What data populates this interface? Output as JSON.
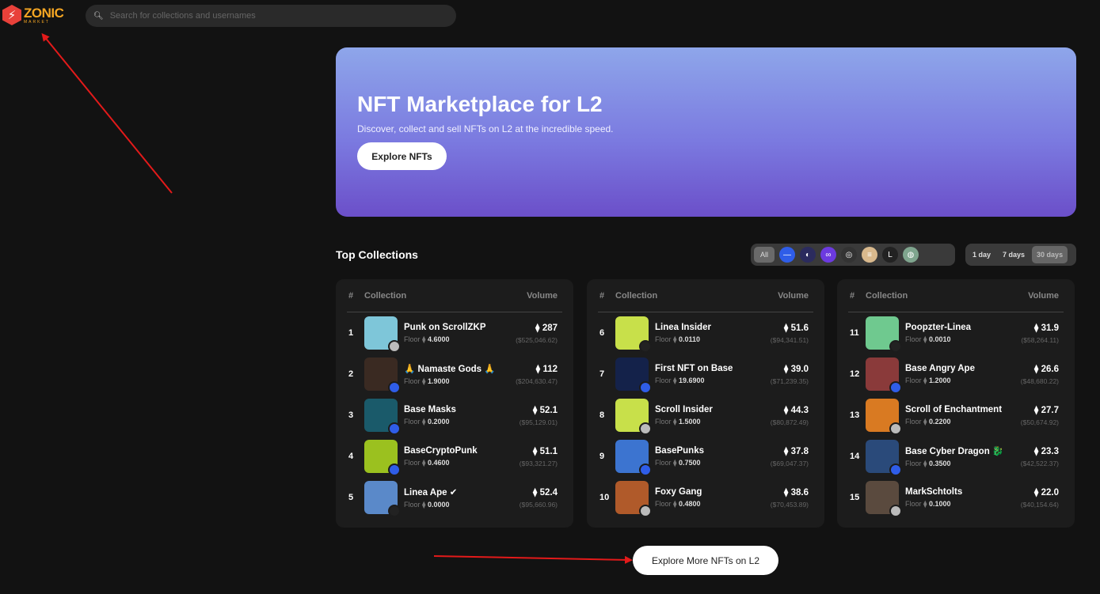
{
  "header": {
    "logo_text": "ZONIC",
    "logo_sub": "MARKET",
    "search_placeholder": "Search for collections and usernames"
  },
  "hero": {
    "title": "NFT Marketplace for L2",
    "subtitle": "Discover, collect and sell NFTs on L2 at the incredible speed.",
    "button": "Explore NFTs"
  },
  "top": {
    "title": "Top Collections",
    "chain_all": "All",
    "chains": [
      {
        "icon": "base-icon",
        "color": "#2f5de8",
        "glyph": "—"
      },
      {
        "icon": "arbitrum-nova-icon",
        "color": "#2b2b5e",
        "glyph": "◐"
      },
      {
        "icon": "polygon-zkevm-icon",
        "color": "#6c3ae0",
        "glyph": "∞"
      },
      {
        "icon": "zora-icon",
        "color": "#333",
        "glyph": "◎"
      },
      {
        "icon": "scroll-icon",
        "color": "#d9b98d",
        "glyph": "≡"
      },
      {
        "icon": "linea-icon",
        "color": "#222",
        "glyph": "L"
      },
      {
        "icon": "globe-icon",
        "color": "#7fa58e",
        "glyph": "◍"
      }
    ],
    "periods": [
      "1 day",
      "7 days",
      "30 days"
    ],
    "active_period": "30 days",
    "head": {
      "num": "#",
      "collection": "Collection",
      "volume": "Volume"
    },
    "floor_label": "Floor",
    "eth": "⧫"
  },
  "columns": [
    [
      {
        "rank": "1",
        "name": "Punk on ScrollZKP",
        "floor": "4.6000",
        "vol": "287",
        "usd": "($525,046.62)",
        "thumb": "#7ec6d9",
        "badge": "#bbb"
      },
      {
        "rank": "2",
        "name": "🙏 Namaste Gods 🙏",
        "floor": "1.9000",
        "vol": "112",
        "usd": "($204,630.47)",
        "thumb": "#3a2a22",
        "badge": "#2f5de8"
      },
      {
        "rank": "3",
        "name": "Base Masks",
        "floor": "0.2000",
        "vol": "52.1",
        "usd": "($95,129.01)",
        "thumb": "#1a5a6a",
        "badge": "#2f5de8"
      },
      {
        "rank": "4",
        "name": "BaseCryptoPunk",
        "floor": "0.4600",
        "vol": "51.1",
        "usd": "($93,321.27)",
        "thumb": "#9bc11f",
        "badge": "#2f5de8"
      },
      {
        "rank": "5",
        "name": "Linea Ape ✔",
        "floor": "0.0000",
        "vol": "52.4",
        "usd": "($95,660.96)",
        "thumb": "#5a89c9",
        "badge": "#222"
      }
    ],
    [
      {
        "rank": "6",
        "name": "Linea Insider",
        "floor": "0.0110",
        "vol": "51.6",
        "usd": "($94,341.51)",
        "thumb": "#c8e04a",
        "badge": "#222"
      },
      {
        "rank": "7",
        "name": "First NFT on Base",
        "floor": "19.6900",
        "vol": "39.0",
        "usd": "($71,239.35)",
        "thumb": "#14224a",
        "badge": "#2f5de8"
      },
      {
        "rank": "8",
        "name": "Scroll Insider",
        "floor": "1.5000",
        "vol": "44.3",
        "usd": "($80,872.49)",
        "thumb": "#c8e04a",
        "badge": "#bbb"
      },
      {
        "rank": "9",
        "name": "BasePunks",
        "floor": "0.7500",
        "vol": "37.8",
        "usd": "($69,047.37)",
        "thumb": "#3c74d0",
        "badge": "#2f5de8"
      },
      {
        "rank": "10",
        "name": "Foxy Gang",
        "floor": "0.4800",
        "vol": "38.6",
        "usd": "($70,453.89)",
        "thumb": "#b05a2a",
        "badge": "#bbb"
      }
    ],
    [
      {
        "rank": "11",
        "name": "Poopzter-Linea",
        "floor": "0.0010",
        "vol": "31.9",
        "usd": "($58,264.11)",
        "thumb": "#6fc98f",
        "badge": "#222"
      },
      {
        "rank": "12",
        "name": "Base Angry Ape",
        "floor": "1.2000",
        "vol": "26.6",
        "usd": "($48,680.22)",
        "thumb": "#8a3a3a",
        "badge": "#2f5de8"
      },
      {
        "rank": "13",
        "name": "Scroll of Enchantment",
        "floor": "0.2200",
        "vol": "27.7",
        "usd": "($50,674.92)",
        "thumb": "#d97a22",
        "badge": "#bbb"
      },
      {
        "rank": "14",
        "name": "Base Cyber Dragon 🐉 ...",
        "floor": "0.3500",
        "vol": "23.3",
        "usd": "($42,522.37)",
        "thumb": "#2a4a7a",
        "badge": "#2f5de8"
      },
      {
        "rank": "15",
        "name": "MarkSchtolts",
        "floor": "0.1000",
        "vol": "22.0",
        "usd": "($40,154.64)",
        "thumb": "#5a4a3e",
        "badge": "#bbb"
      }
    ]
  ],
  "more_button": "Explore More NFTs on L2",
  "annotation_color": "#e31a1a"
}
